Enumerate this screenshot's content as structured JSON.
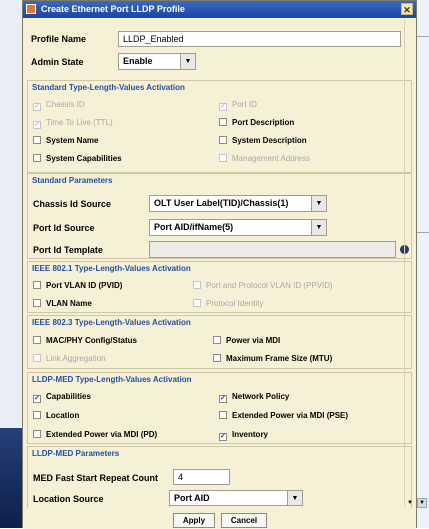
{
  "dialog": {
    "title": "Create Ethernet Port LLDP Profile",
    "close_glyph": "✕"
  },
  "general": {
    "profile_name_label": "Profile Name",
    "profile_name_value": "LLDP_Enabled",
    "admin_state_label": "Admin State",
    "admin_state_value": "Enable"
  },
  "standard_tlv": {
    "title": "Standard Type-Length-Values Activation",
    "items": [
      {
        "label": "Chassis ID",
        "checked": true,
        "enabled": false
      },
      {
        "label": "Port ID",
        "checked": true,
        "enabled": false
      },
      {
        "label": "Time To Live (TTL)",
        "checked": true,
        "enabled": false
      },
      {
        "label": "Port Description",
        "checked": false,
        "enabled": true
      },
      {
        "label": "System Name",
        "checked": false,
        "enabled": true
      },
      {
        "label": "System Description",
        "checked": false,
        "enabled": true
      },
      {
        "label": "System Capabilities",
        "checked": false,
        "enabled": true
      },
      {
        "label": "Management Address",
        "checked": false,
        "enabled": false
      }
    ]
  },
  "standard_params": {
    "title": "Standard Parameters",
    "chassis_id_source_label": "Chassis Id Source",
    "chassis_id_source_value": "OLT User Label(TID)/Chassis(1)",
    "port_id_source_label": "Port Id Source",
    "port_id_source_value": "Port AID/ifName(5)",
    "port_id_template_label": "Port Id Template",
    "port_id_template_value": ""
  },
  "ieee8021": {
    "title": "IEEE 802.1 Type-Length-Values Activation",
    "items": [
      {
        "label": "Port VLAN ID (PVID)",
        "checked": false,
        "enabled": true
      },
      {
        "label": "Port and Protocol VLAN ID (PPVID)",
        "checked": false,
        "enabled": false
      },
      {
        "label": "VLAN Name",
        "checked": false,
        "enabled": true
      },
      {
        "label": "Protocol Identity",
        "checked": false,
        "enabled": false
      }
    ]
  },
  "ieee8023": {
    "title": "IEEE 802.3 Type-Length-Values Activation",
    "items": [
      {
        "label": "MAC/PHY Config/Status",
        "checked": false,
        "enabled": true
      },
      {
        "label": "Power via MDI",
        "checked": false,
        "enabled": true
      },
      {
        "label": "Link Aggregation",
        "checked": false,
        "enabled": false
      },
      {
        "label": "Maximum Frame Size (MTU)",
        "checked": false,
        "enabled": true
      }
    ]
  },
  "lldp_med_tlv": {
    "title": "LLDP-MED Type-Length-Values Activation",
    "items": [
      {
        "label": "Capabilities",
        "checked": true,
        "enabled": true
      },
      {
        "label": "Network Policy",
        "checked": true,
        "enabled": true
      },
      {
        "label": "Location",
        "checked": false,
        "enabled": true
      },
      {
        "label": "Extended Power via MDI (PSE)",
        "checked": false,
        "enabled": true
      },
      {
        "label": "Extended Power via MDI (PD)",
        "checked": false,
        "enabled": true
      },
      {
        "label": "Inventory",
        "checked": true,
        "enabled": true
      }
    ]
  },
  "lldp_med_params": {
    "title": "LLDP-MED Parameters",
    "fast_start_label": "MED Fast Start Repeat Count",
    "fast_start_value": "4",
    "location_source_label": "Location Source",
    "location_source_value": "Port AID"
  },
  "buttons": {
    "apply": "Apply",
    "cancel": "Cancel"
  },
  "glyphs": {
    "check": "✓",
    "dropdown": "▼",
    "info": "i"
  },
  "colors": {
    "section_title": "#2450a0",
    "dialog_bg": "#f6f1d6",
    "titlebar": "#1c45a0"
  }
}
